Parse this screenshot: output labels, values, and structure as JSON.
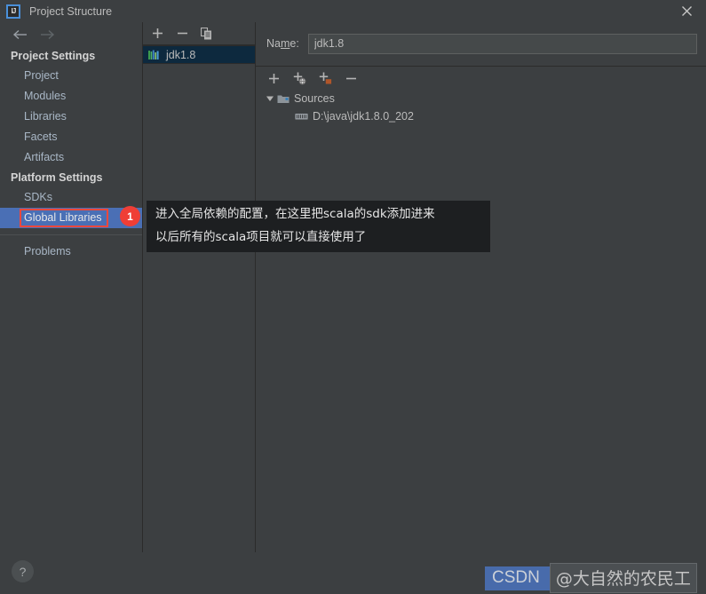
{
  "window": {
    "title": "Project Structure",
    "logo_text": "IJ",
    "close_icon": "close-icon"
  },
  "nav": {
    "back_label": "back-arrow",
    "forward_label": "forward-arrow"
  },
  "sidebar": {
    "groups": [
      {
        "heading": "Project Settings",
        "items": [
          {
            "label": "Project",
            "selected": false
          },
          {
            "label": "Modules",
            "selected": false
          },
          {
            "label": "Libraries",
            "selected": false
          },
          {
            "label": "Facets",
            "selected": false
          },
          {
            "label": "Artifacts",
            "selected": false
          }
        ]
      },
      {
        "heading": "Platform Settings",
        "items": [
          {
            "label": "SDKs",
            "selected": false
          },
          {
            "label": "Global Libraries",
            "selected": true
          }
        ]
      }
    ],
    "footer_items": [
      {
        "label": "Problems"
      }
    ],
    "badge": "1",
    "highlight_color": "#f0483c",
    "selection_color": "#4a6fb5",
    "badge_color": "#ef3e36"
  },
  "middle_panel": {
    "toolbar": [
      {
        "name": "add-button",
        "glyph": "+"
      },
      {
        "name": "remove-button",
        "glyph": "−"
      },
      {
        "name": "copy-button",
        "glyph": "copy"
      }
    ],
    "items": [
      {
        "label": "jdk1.8",
        "selected": true,
        "icon": "sdk-icon"
      }
    ]
  },
  "right_panel": {
    "name_label": "Name:",
    "name_value": "jdk1.8",
    "name_placeholder": "",
    "toolbar": [
      {
        "name": "add-path-button",
        "glyph": "+"
      },
      {
        "name": "add-url-button",
        "glyph": "+globe"
      },
      {
        "name": "add-folder-button",
        "glyph": "+folder"
      },
      {
        "name": "remove-path-button",
        "glyph": "−"
      }
    ],
    "tree": {
      "root_label": "Sources",
      "root_expanded": true,
      "children": [
        {
          "label": "D:\\java\\jdk1.8.0_202"
        }
      ]
    }
  },
  "tooltip": {
    "line1": "进入全局依赖的配置，在这里把scala的sdk添加进来",
    "line2": "以后所有的scala项目就可以直接使用了",
    "bg_color": "#1d1f21"
  },
  "bottom": {
    "help_glyph": "?",
    "watermark_brand": "CSDN",
    "watermark_user": "@大自然的农民工"
  }
}
